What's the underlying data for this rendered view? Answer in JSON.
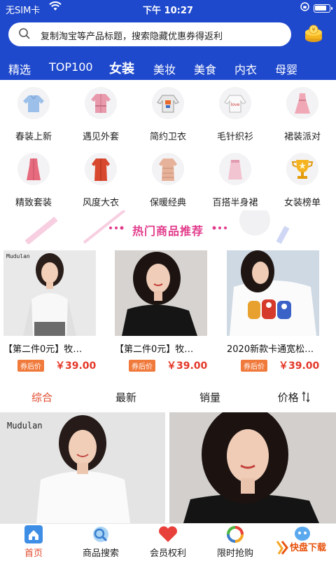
{
  "status_bar": {
    "carrier": "无SIM卡",
    "time": "下午 10:27"
  },
  "search": {
    "placeholder": "复制淘宝等产品标题，搜索隐藏优惠券得返利"
  },
  "categories": [
    "精选",
    "TOP100",
    "女装",
    "美妆",
    "美食",
    "内衣",
    "母婴"
  ],
  "active_category": "女装",
  "grid": [
    {
      "label": "春装上新",
      "icon": "blouse-icon"
    },
    {
      "label": "遇见外套",
      "icon": "coat-icon"
    },
    {
      "label": "简约卫衣",
      "icon": "sweatshirt-icon"
    },
    {
      "label": "毛针织衫",
      "icon": "knit-sweater-icon"
    },
    {
      "label": "裙装派对",
      "icon": "dress-icon"
    },
    {
      "label": "精致套装",
      "icon": "suit-dress-icon"
    },
    {
      "label": "风度大衣",
      "icon": "overcoat-icon"
    },
    {
      "label": "保暖经典",
      "icon": "down-jacket-icon"
    },
    {
      "label": "百搭半身裙",
      "icon": "skirt-icon"
    },
    {
      "label": "女装榜单",
      "icon": "trophy-icon"
    }
  ],
  "hot_section": {
    "title": "热门商品推荐"
  },
  "hot_products": [
    {
      "name": "【第二件0元】牧…",
      "tag": "券后价",
      "price": "￥39.00",
      "image_text": "Mudulan"
    },
    {
      "name": "【第二件0元】牧…",
      "tag": "券后价",
      "price": "￥39.00",
      "image_text": ""
    },
    {
      "name": "2020新款卡通宽松…",
      "tag": "券后价",
      "price": "￥39.00",
      "image_text": ""
    }
  ],
  "sort_options": [
    "综合",
    "最新",
    "销量",
    "价格"
  ],
  "active_sort": "综合",
  "big_products": [
    {
      "image_text": "Mudulan"
    },
    {
      "image_text": ""
    }
  ],
  "tabbar": [
    {
      "label": "首页",
      "icon": "home-icon"
    },
    {
      "label": "商品搜索",
      "icon": "search-globe-icon"
    },
    {
      "label": "会员权利",
      "icon": "heart-icon"
    },
    {
      "label": "限时抢购",
      "icon": "rainbow-ring-icon"
    },
    {
      "label": "",
      "icon": "chat-bubble-icon"
    }
  ],
  "active_tab": "首页",
  "watermark": {
    "text": "快盘下载"
  },
  "colors": {
    "header_blue": "#1f49cc",
    "accent_red": "#e0492b",
    "hot_pink": "#e23c8c",
    "tag_orange": "#f07a3c"
  }
}
